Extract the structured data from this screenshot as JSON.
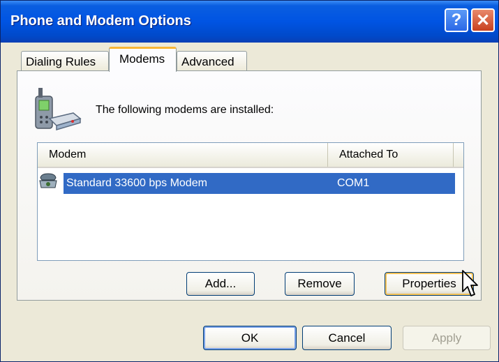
{
  "window": {
    "title": "Phone and Modem Options"
  },
  "title_buttons": {
    "help": "?",
    "close": "✕"
  },
  "tabs": [
    {
      "label": "Dialing Rules",
      "active": false
    },
    {
      "label": "Modems",
      "active": true
    },
    {
      "label": "Advanced",
      "active": false
    }
  ],
  "panel": {
    "intro_text": "The following modems are  installed:",
    "icon": "phone-modem-icon",
    "modem_list": {
      "columns": [
        "Modem",
        "Attached To"
      ],
      "rows": [
        {
          "icon": "modem-icon",
          "modem": "Standard 33600 bps Modem",
          "attached_to": "COM1",
          "selected": true
        }
      ]
    },
    "buttons": {
      "add": "Add...",
      "remove": "Remove",
      "properties": "Properties"
    }
  },
  "footer": {
    "ok": "OK",
    "cancel": "Cancel",
    "apply": "Apply"
  },
  "colors": {
    "title_bar": "#0054e3",
    "selection": "#316ac5",
    "dialog_bg": "#ece9d8",
    "tab_highlight": "#f8b636"
  }
}
